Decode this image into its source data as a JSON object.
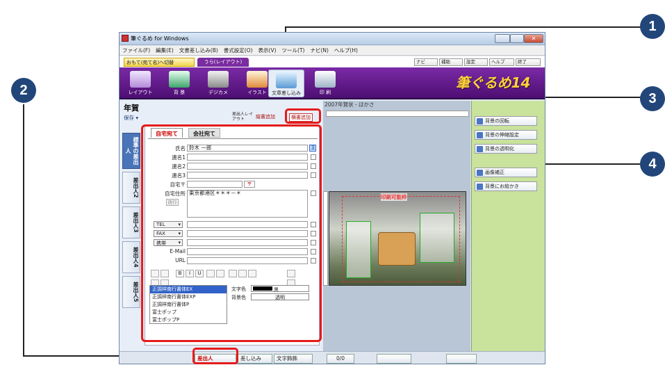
{
  "window": {
    "title": "筆ぐるめ for Windows",
    "minimize": "–",
    "maximize": "□",
    "close": "✕"
  },
  "menu": [
    "ファイル(F)",
    "編集(E)",
    "文書差し込み(B)",
    "書式設定(O)",
    "表示(V)",
    "ツール(T)",
    "ナビ(N)",
    "ヘルプ(H)"
  ],
  "tabs": {
    "front": "おもて(宛て名)へ切替",
    "back": "うら(レイアウト)"
  },
  "help_buttons": [
    "ナビ",
    "補助",
    "設定",
    "ヘルプ",
    "終了"
  ],
  "ribbon": {
    "buttons": [
      "レイアウト",
      "背 景",
      "デジカメ",
      "イラスト",
      "文章差し込み",
      "印 刷"
    ],
    "logo": "筆ぐるめ14"
  },
  "page_title": "年賀",
  "toolbar": {
    "save": "保存",
    "sender_layout": "差出人レイアウト",
    "vertical_add": "縦書追加",
    "horizontal_add": "横書追加"
  },
  "document_name": "2007年賀状 - ほかさ",
  "side_tabs": [
    "標準の差出人",
    "差出人2",
    "差出人3",
    "差出人4",
    "差出人5"
  ],
  "panel_tabs": {
    "home": "自宅宛て",
    "company": "会社宛て"
  },
  "fields": [
    {
      "label": "氏名",
      "value": "鈴木 一郎"
    },
    {
      "label": "連名1",
      "value": ""
    },
    {
      "label": "連名2",
      "value": ""
    },
    {
      "label": "連名3",
      "value": ""
    },
    {
      "label": "自宅〒",
      "value": ""
    },
    {
      "label": "自宅住所",
      "value": "東京都港区＊＊＊－＊"
    }
  ],
  "kanji_button": "漢",
  "postal_button": "〒",
  "newline_button": "改行",
  "contact_types": [
    "TEL",
    "FAX",
    "携帯"
  ],
  "email_label": "E-Mail",
  "url_label": "URL",
  "fonts": [
    "正調祥南行書体EX",
    "正調祥南行書体EXP",
    "正調祥南行書体P",
    "富士ポップ",
    "富士ポップP"
  ],
  "color_labels": {
    "text": "文字色",
    "bg": "背景色"
  },
  "color_values": {
    "text": "黒",
    "bg": "透明"
  },
  "right_buttons": [
    "背景の回転",
    "背景の伸縮設定",
    "背景の透明化",
    "画像補正",
    "背景にお絵かき"
  ],
  "preview_label": "印刷可能枠",
  "status": {
    "sender": "差出人",
    "insert": "差し込み",
    "text_deco": "文字飾飾",
    "page": "0/0"
  },
  "callouts": [
    "1",
    "2",
    "3",
    "4"
  ],
  "colors": {
    "accent_red": "#e51b1b",
    "callout_navy": "#22467a",
    "ribbon_purple": "#5a1585",
    "right_pane": "#c9e29c"
  }
}
